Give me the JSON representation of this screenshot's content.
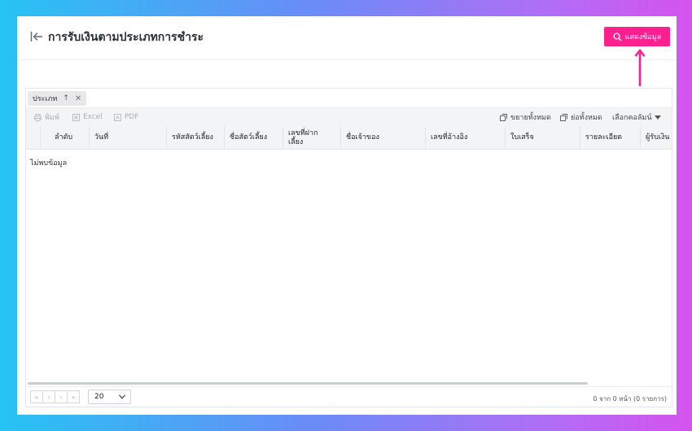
{
  "header": {
    "title": "การรับเงินตามประเภทการชำระ",
    "show_button_label": "แสดงข้อมูล",
    "accent_color": "#ff1f8f"
  },
  "grouping": {
    "chip_label": "ประเภท",
    "sort_icon": "arrow-up-icon",
    "remove_icon": "close-icon"
  },
  "toolbar": {
    "print_label": "พิมพ์",
    "excel_label": "Excel",
    "pdf_label": "PDF",
    "expand_all_label": "ขยายทั้งหมด",
    "collapse_all_label": "ย่อทั้งหมด",
    "choose_columns_label": "เลือกคอลัมน์"
  },
  "table": {
    "columns": [
      "ลำดับ",
      "วันที่",
      "รหัสสัตว์เลี้ยง",
      "ชื่อสัตว์เลี้ยง",
      "เลขที่ฝากเลี้ยง",
      "ชื่อเจ้าของ",
      "เลขที่อ้างอิง",
      "ใบเสร็จ",
      "รายละเอียด",
      "ผู้รับเงิน"
    ],
    "empty_message": "ไม่พบข้อมูล"
  },
  "pager": {
    "first": "«",
    "prev": "‹",
    "next": "›",
    "last": "»",
    "page_size": "20",
    "info": "0 จาก 0 หน้า (0 รายการ)"
  }
}
